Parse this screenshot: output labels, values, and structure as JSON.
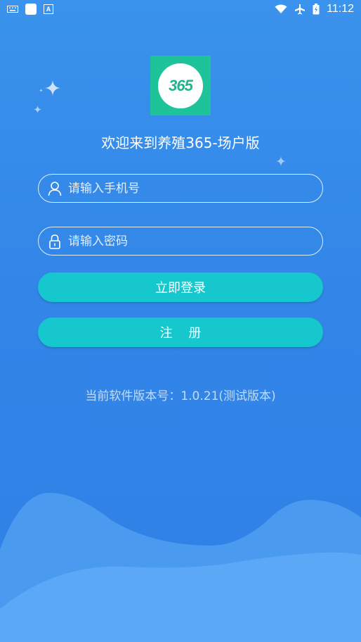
{
  "status_bar": {
    "time": "11:12",
    "icons": [
      "keyboard-icon",
      "app-icon",
      "a-icon",
      "wifi-icon",
      "airplane-icon",
      "battery-icon"
    ]
  },
  "logo": {
    "text": "365"
  },
  "welcome": "欢迎来到养殖365-场户版",
  "phone_input": {
    "placeholder": "请输入手机号",
    "value": "",
    "icon": "user-icon"
  },
  "password_input": {
    "placeholder": "请输入密码",
    "value": "",
    "icon": "lock-icon"
  },
  "login_button": "立即登录",
  "register_button": "注    册",
  "version_text": "当前软件版本号：1.0.21(测试版本)",
  "colors": {
    "background": "#3387e8",
    "button": "#16c7cd",
    "logo_bg": "#1fc39a",
    "wave_dark": "#4a9af0",
    "wave_light": "#5aa8f6"
  }
}
